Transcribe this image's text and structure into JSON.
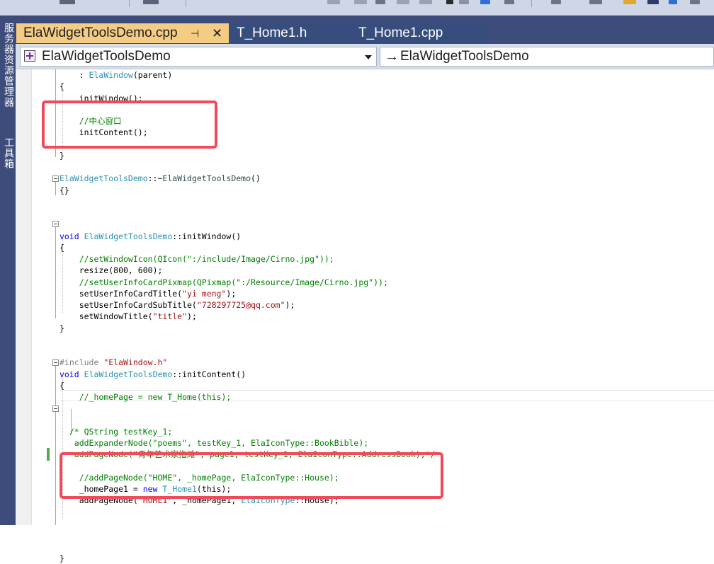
{
  "side_panel": {
    "tabs": [
      "服务器资源管理器",
      "工具箱"
    ]
  },
  "tabs": [
    {
      "label": "ElaWidgetToolsDemo.cpp",
      "active": true,
      "pin_icon": "pin-icon",
      "close_icon": "close-icon"
    },
    {
      "label": "T_Home1.h",
      "active": false
    },
    {
      "label": "T_Home1.cpp",
      "active": false
    }
  ],
  "navbar": {
    "scope_combo": "ElaWidgetToolsDemo",
    "member_combo": "ElaWidgetToolsDemo"
  },
  "colors": {
    "keyword": "#0000ff",
    "type": "#2b91af",
    "comment": "#008000",
    "string": "#a31515",
    "highlight": "#f04b5b",
    "active_tab": "#f5cc84",
    "tool_window_bg": "#3d4c7a"
  },
  "code": {
    "lines": [
      [
        {
          "t": "    : "
        },
        {
          "t": "ElaWindow",
          "c": "ty"
        },
        {
          "t": "(parent)"
        }
      ],
      [
        {
          "t": "{"
        }
      ],
      [
        {
          "t": "    initWindow();"
        }
      ],
      [
        {
          "t": ""
        }
      ],
      [
        {
          "t": "    //中心窗口",
          "c": "cm"
        }
      ],
      [
        {
          "t": "    initContent();"
        }
      ],
      [
        {
          "t": ""
        }
      ],
      [
        {
          "t": "}"
        }
      ],
      [
        {
          "t": ""
        }
      ],
      [
        {
          "t": "ElaWidgetToolsDemo",
          "c": "ty"
        },
        {
          "t": "::~"
        },
        {
          "t": "ElaWidgetToolsDemo",
          "c": "en"
        },
        {
          "t": "()"
        }
      ],
      [
        {
          "t": "{}"
        }
      ],
      [
        {
          "t": ""
        }
      ],
      [
        {
          "t": ""
        }
      ],
      [
        {
          "t": ""
        }
      ],
      [
        {
          "t": "void",
          "c": "kw"
        },
        {
          "t": " "
        },
        {
          "t": "ElaWidgetToolsDemo",
          "c": "ty"
        },
        {
          "t": "::initWindow()"
        }
      ],
      [
        {
          "t": "{"
        }
      ],
      [
        {
          "t": "    //setWindowIcon(QIcon(\":/include/Image/Cirno.jpg\"));",
          "c": "cm"
        }
      ],
      [
        {
          "t": "    resize(800, 600);"
        }
      ],
      [
        {
          "t": "    //setUserInfoCardPixmap(QPixmap(\":/Resource/Image/Cirno.jpg\"));",
          "c": "cm"
        }
      ],
      [
        {
          "t": "    setUserInfoCardTitle("
        },
        {
          "t": "\"yi meng\"",
          "c": "st"
        },
        {
          "t": ");"
        }
      ],
      [
        {
          "t": "    setUserInfoCardSubTitle("
        },
        {
          "t": "\"728297725@qq.com\"",
          "c": "st"
        },
        {
          "t": ");"
        }
      ],
      [
        {
          "t": "    setWindowTitle("
        },
        {
          "t": "\"title\"",
          "c": "st"
        },
        {
          "t": ");"
        }
      ],
      [
        {
          "t": "}"
        }
      ],
      [
        {
          "t": ""
        }
      ],
      [
        {
          "t": ""
        }
      ],
      [
        {
          "t": "#include",
          "c": "pp"
        },
        {
          "t": " "
        },
        {
          "t": "\"ElaWindow.h\"",
          "c": "st"
        }
      ],
      [
        {
          "t": "void",
          "c": "kw"
        },
        {
          "t": " "
        },
        {
          "t": "ElaWidgetToolsDemo",
          "c": "ty"
        },
        {
          "t": "::initContent()"
        }
      ],
      [
        {
          "t": "{"
        }
      ],
      [
        {
          "t": "    //_homePage = new T_Home(this);",
          "c": "cm"
        }
      ],
      [
        {
          "t": ""
        }
      ],
      [
        {
          "t": ""
        }
      ],
      [
        {
          "t": "  /* QString testKey_1;",
          "c": "cm"
        }
      ],
      [
        {
          "t": "   addExpanderNode(\"poems\", testKey_1, ElaIconType::BookBible);",
          "c": "cm"
        }
      ],
      [
        {
          "t": "   addPageNode(\"青年艺术家指滩\", page1, testKey_1, ElaIconType::AddressBook);*/",
          "c": "cm"
        }
      ],
      [
        {
          "t": ""
        }
      ],
      [
        {
          "t": "    //addPageNode(\"HOME\", _homePage, ElaIconType::House);",
          "c": "cm"
        }
      ],
      [
        {
          "t": "    _homePage1 = "
        },
        {
          "t": "new",
          "c": "kw"
        },
        {
          "t": " "
        },
        {
          "t": "T_Home1",
          "c": "ty"
        },
        {
          "t": "(this);"
        }
      ],
      [
        {
          "t": "    addPageNode("
        },
        {
          "t": "\"HOME1\"",
          "c": "st"
        },
        {
          "t": ", _homePage1, "
        },
        {
          "t": "ElaIconType",
          "c": "ty"
        },
        {
          "t": "::House);"
        }
      ],
      [
        {
          "t": ""
        }
      ],
      [
        {
          "t": ""
        }
      ],
      [
        {
          "t": ""
        }
      ],
      [
        {
          "t": ""
        }
      ],
      [
        {
          "t": "}"
        }
      ]
    ]
  }
}
